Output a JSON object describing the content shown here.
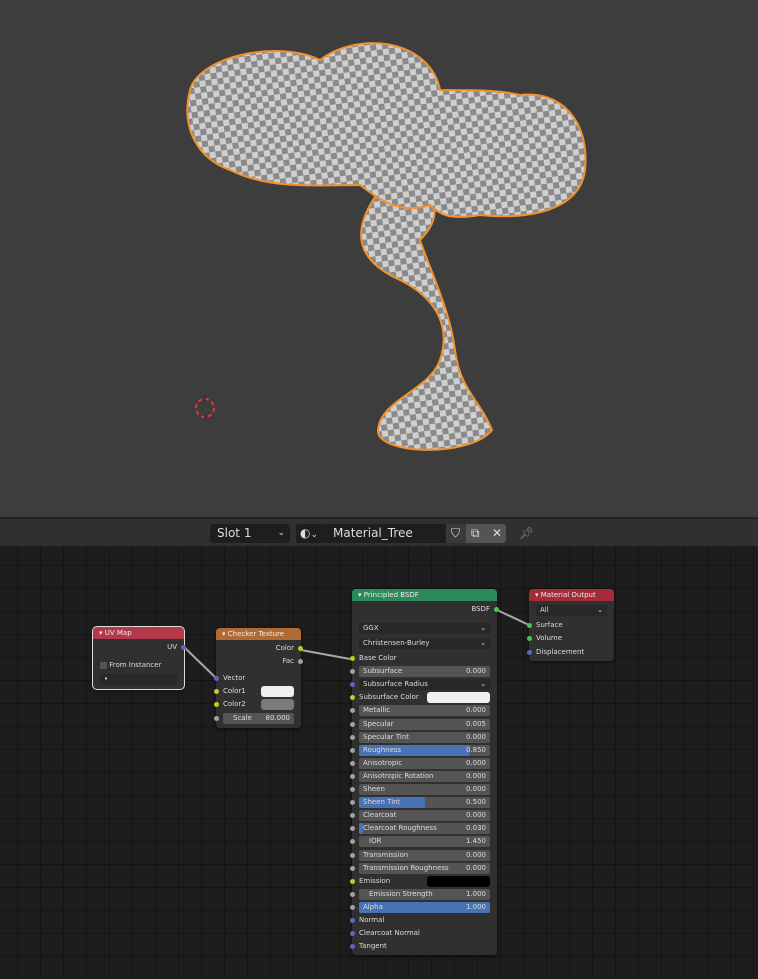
{
  "header": {
    "slot": "Slot 1",
    "material_name": "Material_Tree"
  },
  "colors": {
    "selection_outline": "#f0912d",
    "shader_header": "#2a8a5a",
    "texture_header": "#b06a35",
    "input_header": "#b3394a",
    "output_header": "#a52a3a",
    "value_bar": "#4772b3"
  },
  "uv_map": {
    "title": "UV Map",
    "output": "UV",
    "from_instancer": "From Instancer",
    "uv_field": "•"
  },
  "checker": {
    "title": "Checker Texture",
    "outputs": [
      "Color",
      "Fac"
    ],
    "vector": "Vector",
    "color1": "Color1",
    "color2": "Color2",
    "scale_label": "Scale",
    "scale_value": "80.000"
  },
  "principled": {
    "title": "Principled BSDF",
    "output": "BSDF",
    "distribution": "GGX",
    "subsurface_method": "Christensen-Burley",
    "rows": [
      {
        "label": "Base Color",
        "type": "socket",
        "sock": "#c7c729"
      },
      {
        "label": "Subsurface",
        "type": "value",
        "value": "0.000",
        "fill": 0
      },
      {
        "label": "Subsurface Radius",
        "type": "drop",
        "sock": "#6363c7"
      },
      {
        "label": "Subsurface Color",
        "type": "color",
        "swatch": "#f0f0f0",
        "sock": "#c7c729"
      },
      {
        "label": "Metallic",
        "type": "value",
        "value": "0.000",
        "fill": 0
      },
      {
        "label": "Specular",
        "type": "value",
        "value": "0.005",
        "fill": 0
      },
      {
        "label": "Specular Tint",
        "type": "value",
        "value": "0.000",
        "fill": 0
      },
      {
        "label": "Roughness",
        "type": "value",
        "value": "0.850",
        "fill": 0.85
      },
      {
        "label": "Anisotropic",
        "type": "value",
        "value": "0.000",
        "fill": 0
      },
      {
        "label": "Anisotropic Rotation",
        "type": "value",
        "value": "0.000",
        "fill": 0
      },
      {
        "label": "Sheen",
        "type": "value",
        "value": "0.000",
        "fill": 0
      },
      {
        "label": "Sheen Tint",
        "type": "value",
        "value": "0.500",
        "fill": 0.5
      },
      {
        "label": "Clearcoat",
        "type": "value",
        "value": "0.000",
        "fill": 0
      },
      {
        "label": "Clearcoat Roughness",
        "type": "value",
        "value": "0.030",
        "fill": 0.03
      },
      {
        "label": "IOR",
        "type": "value",
        "value": "1.450",
        "fill": 0,
        "indent": true
      },
      {
        "label": "Transmission",
        "type": "value",
        "value": "0.000",
        "fill": 0
      },
      {
        "label": "Transmission Roughness",
        "type": "value",
        "value": "0.000",
        "fill": 0
      },
      {
        "label": "Emission",
        "type": "color",
        "swatch": "#000000",
        "sock": "#c7c729"
      },
      {
        "label": "Emission Strength",
        "type": "value",
        "value": "1.000",
        "fill": 0,
        "indent": true
      },
      {
        "label": "Alpha",
        "type": "value",
        "value": "1.000",
        "fill": 1
      },
      {
        "label": "Normal",
        "type": "socket",
        "sock": "#6363c7"
      },
      {
        "label": "Clearcoat Normal",
        "type": "socket",
        "sock": "#6363c7"
      },
      {
        "label": "Tangent",
        "type": "socket",
        "sock": "#6363c7"
      }
    ]
  },
  "output": {
    "title": "Material Output",
    "target": "All",
    "inputs": [
      "Surface",
      "Volume",
      "Displacement"
    ]
  }
}
